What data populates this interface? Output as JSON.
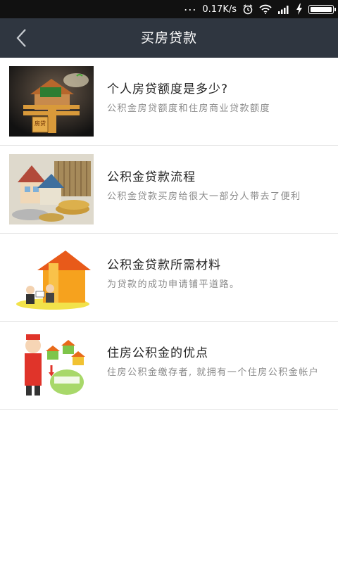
{
  "status_bar": {
    "dots": "...",
    "net_speed": "0.17K/s"
  },
  "header": {
    "title": "买房贷款",
    "background_color": "#2f3640"
  },
  "items": [
    {
      "title": "个人房贷额度是多少?",
      "desc": "公积金房贷额度和住房商业贷款额度",
      "image_label": "房贷"
    },
    {
      "title": "公积金贷款流程",
      "desc": "公积金贷款买房给很大一部分人带去了便利"
    },
    {
      "title": "公积金贷款所需材料",
      "desc": "为贷款的成功申请铺平道路。"
    },
    {
      "title": "住房公积金的优点",
      "desc": "住房公积金缴存者, 就拥有一个住房公积金帐户"
    }
  ]
}
